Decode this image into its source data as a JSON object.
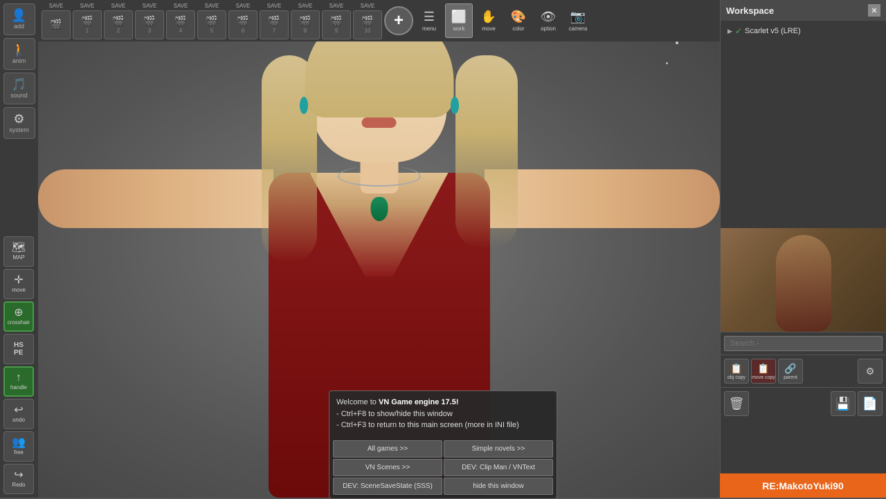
{
  "app": {
    "title": "VN Game Engine 17.5"
  },
  "workspace": {
    "title": "Workspace",
    "close_label": "✕",
    "tree_items": [
      {
        "arrow": "▶",
        "check": "✓",
        "label": "Scarlet v5 (LRE)"
      }
    ],
    "search_placeholder": "Search -"
  },
  "toolbar": {
    "saves": [
      {
        "label": "SAVE",
        "num": ""
      },
      {
        "label": "SAVE",
        "num": "1"
      },
      {
        "label": "SAVE",
        "num": "2"
      },
      {
        "label": "SAVE",
        "num": "3"
      },
      {
        "label": "SAVE",
        "num": "4"
      },
      {
        "label": "SAVE",
        "num": "5"
      },
      {
        "label": "SAVE",
        "num": "6"
      },
      {
        "label": "SAVE",
        "num": "7"
      },
      {
        "label": "SAVE",
        "num": "8"
      },
      {
        "label": "SAVE",
        "num": "9"
      },
      {
        "label": "SAVE",
        "num": "10"
      }
    ],
    "plus_label": "+",
    "tools": [
      {
        "id": "menu",
        "label": "menu",
        "icon": "☰"
      },
      {
        "id": "work",
        "label": "work",
        "icon": "⬜"
      },
      {
        "id": "move",
        "label": "move",
        "icon": "✋"
      },
      {
        "id": "color",
        "label": "color",
        "icon": "🎨"
      },
      {
        "id": "option",
        "label": "option",
        "icon": "👁"
      },
      {
        "id": "camera",
        "label": "camera",
        "icon": "📷"
      }
    ]
  },
  "left_sidebar": [
    {
      "id": "add",
      "label": "add",
      "icon": "👤"
    },
    {
      "id": "anim",
      "label": "anim",
      "icon": "🚶"
    },
    {
      "id": "sound",
      "label": "sound",
      "icon": "🎵"
    },
    {
      "id": "system",
      "label": "system",
      "icon": "⚙"
    }
  ],
  "bottom_left": [
    {
      "id": "map",
      "label": "MAP",
      "icon": "🗺",
      "color": "#4a4a4a"
    },
    {
      "id": "move",
      "label": "move",
      "icon": "✛",
      "color": "#4a4a4a"
    },
    {
      "id": "crosshair",
      "label": "crosshair",
      "icon": "⊕",
      "color": "#2a7a2a"
    },
    {
      "id": "hs-pe",
      "label": "HS PE",
      "icon": "HS",
      "color": "#4a4a4a"
    },
    {
      "id": "handle",
      "label": "handle",
      "icon": "↑",
      "color": "#4a9a4a"
    },
    {
      "id": "undo",
      "label": "undo",
      "icon": "↩",
      "color": "#4a4a4a"
    },
    {
      "id": "free",
      "label": "free",
      "icon": "👥",
      "color": "#4a4a4a"
    },
    {
      "id": "redo",
      "label": "Redo",
      "icon": "↪",
      "color": "#4a4a4a"
    }
  ],
  "workspace_actions": [
    {
      "id": "obj-copy",
      "label": "obj copy",
      "icon": "📋",
      "disabled": false
    },
    {
      "id": "move-copy",
      "label": "move copy",
      "icon": "📋",
      "disabled": false
    },
    {
      "id": "parent",
      "label": "parent",
      "icon": "🔗",
      "disabled": false
    },
    {
      "id": "settings",
      "label": "settings",
      "icon": "⚙",
      "disabled": false
    }
  ],
  "workspace_bottom": [
    {
      "id": "delete",
      "label": "delete",
      "icon": "🗑"
    },
    {
      "id": "save-file",
      "label": "save file",
      "icon": "💾"
    }
  ],
  "info_dialog": {
    "welcome_text": "Welcome to ",
    "app_name": "VN Game engine 17.5!",
    "lines": [
      "- Ctrl+F8 to show/hide this window",
      "- Ctrl+F3 to return to this main screen (more in INI file)"
    ],
    "buttons": [
      {
        "id": "all-games",
        "label": "All games >>"
      },
      {
        "id": "simple-novels",
        "label": "Simple novels >>"
      },
      {
        "id": "vn-scenes",
        "label": "VN Scenes >>"
      },
      {
        "id": "clip-man",
        "label": "DEV: Clip Man / VNText"
      },
      {
        "id": "scene-save",
        "label": "DEV: SceneSaveState (SSS)"
      },
      {
        "id": "hide-window",
        "label": "hide this window"
      }
    ]
  },
  "bottom_badge": {
    "text": "RE:MakotoYuki90",
    "bg_color": "#e8651a"
  }
}
